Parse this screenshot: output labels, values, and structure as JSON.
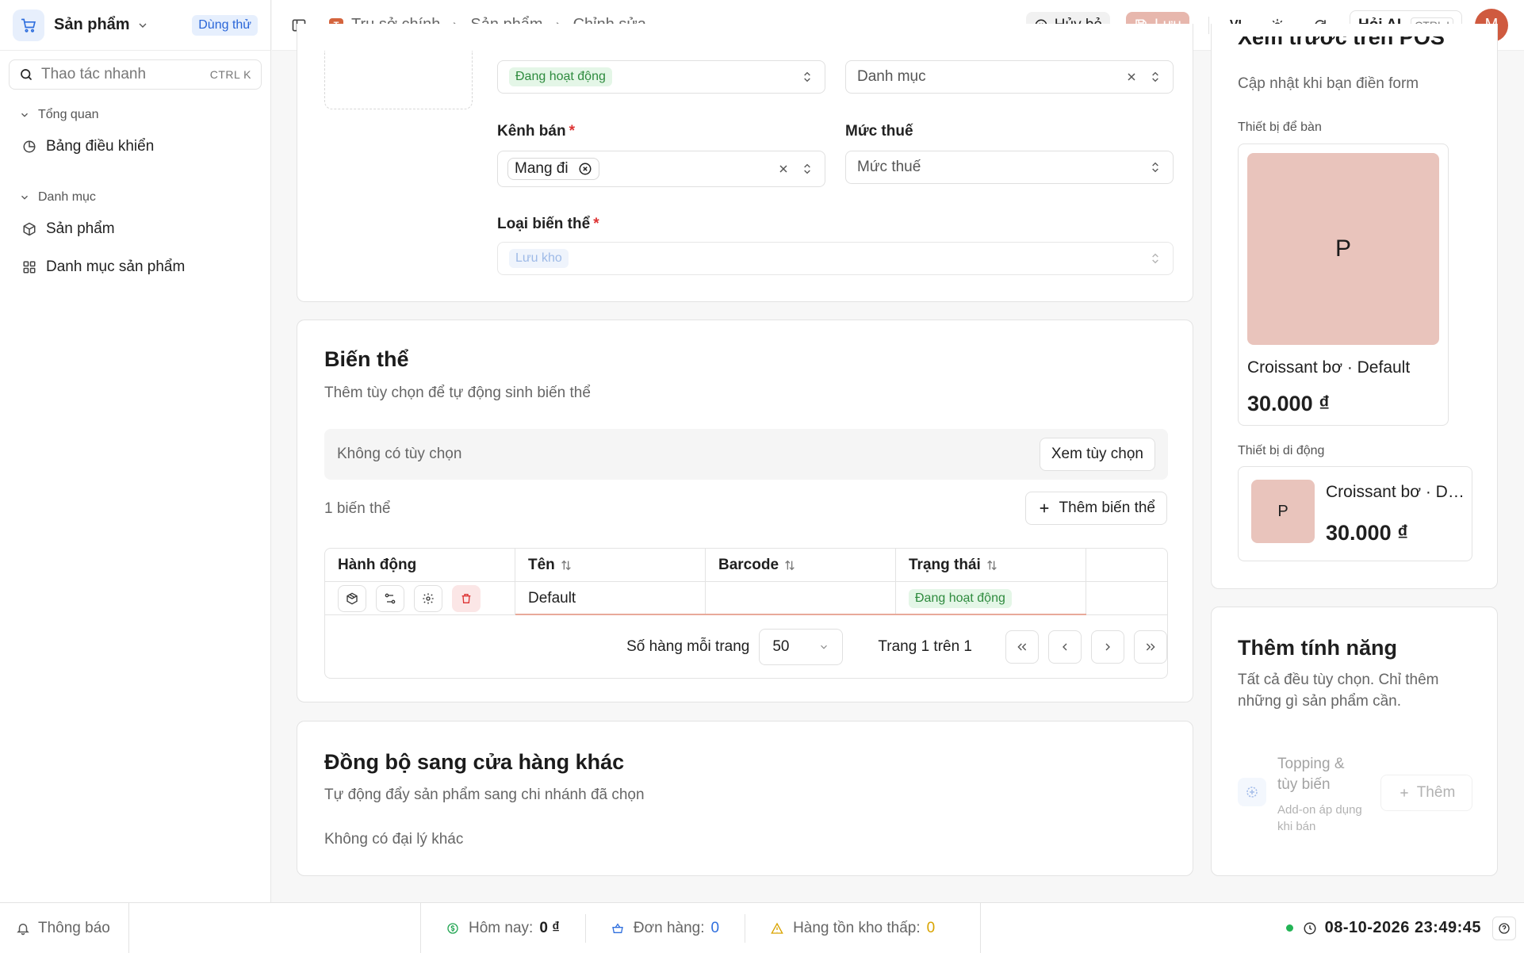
{
  "sidebar": {
    "app_name": "Sản phẩm",
    "trial_badge": "Dùng thử",
    "quick_action": {
      "placeholder": "Thao tác nhanh",
      "shortcut": "CTRL K"
    },
    "groups": [
      {
        "label": "Tổng quan",
        "items": [
          {
            "label": "Bảng điều khiển",
            "icon": "pie-chart-icon"
          }
        ]
      },
      {
        "label": "Danh mục",
        "items": [
          {
            "label": "Sản phẩm",
            "icon": "box-icon"
          },
          {
            "label": "Danh mục sản phẩm",
            "icon": "grid-icon"
          }
        ]
      }
    ]
  },
  "topbar": {
    "breadcrumbs": [
      "Trụ sở chính",
      "Sản phẩm",
      "Chỉnh sửa"
    ],
    "org_logo_letter": "T",
    "cancel_label": "Hủy bỏ",
    "save_label": "Lưu",
    "language": "VI",
    "ai_label": "Hỏi AI",
    "ai_shortcut": "CTRL I",
    "avatar_letter": "M"
  },
  "basic_info": {
    "status_value": "Đang hoạt động",
    "category_placeholder": "Danh mục",
    "sales_channel": {
      "label": "Kênh bán",
      "chip": "Mang đi"
    },
    "tax_rate": {
      "label": "Mức thuế",
      "placeholder": "Mức thuế"
    },
    "variant_type": {
      "label": "Loại biến thể",
      "value": "Lưu kho"
    },
    "required_mark": "*"
  },
  "variants": {
    "title": "Biến thể",
    "subtitle": "Thêm tùy chọn để tự động sinh biến thể",
    "no_options": "Không có tùy chọn",
    "view_options_label": "Xem tùy chọn",
    "count_label": "1 biến thể",
    "add_variant_label": "Thêm biến thể",
    "table": {
      "columns": [
        "Hành động",
        "Tên",
        "Barcode",
        "Trạng thái"
      ],
      "rows": [
        {
          "name": "Default",
          "barcode": "",
          "status": "Đang hoạt động"
        }
      ]
    },
    "pagination": {
      "rows_per_page_label": "Số hàng mỗi trang",
      "rows_per_page": "50",
      "page_info": "Trang 1 trên 1"
    }
  },
  "sync": {
    "title": "Đồng bộ sang cửa hàng khác",
    "subtitle": "Tự động đẩy sản phẩm sang chi nhánh đã chọn",
    "empty": "Không có đại lý khác"
  },
  "preview": {
    "title": "Xem trước trên POS",
    "subtitle": "Cập nhật khi bạn điền form",
    "desktop_label": "Thiết bị để bàn",
    "mobile_label": "Thiết bị di động",
    "product_initial": "P",
    "product_name": "Croissant bơ · Default",
    "product_price": "30.000 ₫"
  },
  "features": {
    "title": "Thêm tính năng",
    "subtitle": "Tất cả đều tùy chọn. Chỉ thêm những gì sản phẩm cần.",
    "item": {
      "name": "Topping & tùy biến",
      "desc": "Add-on áp dụng khi bán",
      "add_label": "Thêm"
    }
  },
  "statusbar": {
    "notifications": "Thông báo",
    "today_label": "Hôm nay:",
    "today_value": "0 ₫",
    "orders_label": "Đơn hàng:",
    "orders_value": "0",
    "low_stock_label": "Hàng tồn kho thấp:",
    "low_stock_value": "0",
    "datetime": "08-10-2026 23:49:45"
  }
}
